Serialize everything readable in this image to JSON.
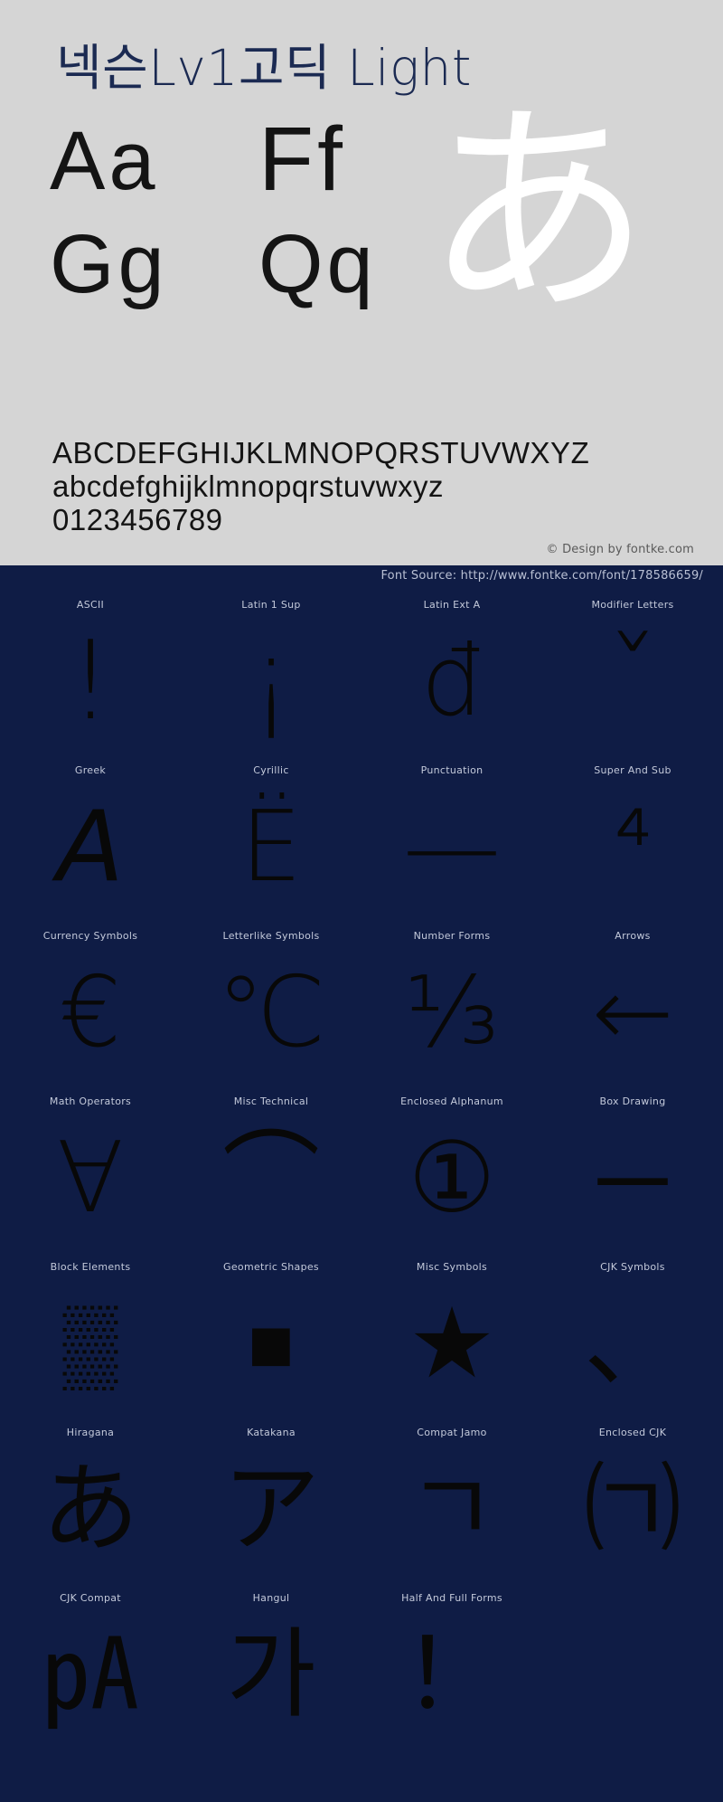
{
  "specimen": {
    "title": "넥슨Lv1고딕 Light",
    "sample_pairs": [
      "Aa",
      "Ff",
      "Gg",
      "Qq"
    ],
    "decorative_glyph": "あ",
    "alphabet_upper": "ABCDEFGHIJKLMNOPQRSTUVWXYZ",
    "alphabet_lower": "abcdefghijklmnopqrstuvwxyz",
    "digits": "0123456789",
    "credit": "© Design by fontke.com",
    "colors": {
      "background": "#d5d5d5",
      "title": "#1b2a52",
      "glyph": "#141414",
      "decorative": "#ffffff",
      "credit": "#5a5a5a"
    }
  },
  "charset": {
    "source_text": "Font Source: http://www.fontke.com/font/178586659/",
    "colors": {
      "background": "#0f1c45",
      "label": "#c3c9da",
      "glyph": "#080808",
      "source": "#b9c0d4"
    },
    "rows": [
      [
        {
          "label": "ASCII",
          "glyph": "!",
          "size": "lg"
        },
        {
          "label": "Latin 1 Sup",
          "glyph": "¡",
          "size": "lg"
        },
        {
          "label": "Latin Ext A",
          "glyph": "đ",
          "size": ""
        },
        {
          "label": "Modifier Letters",
          "glyph": "ˇ",
          "size": "lg"
        }
      ],
      [
        {
          "label": "Greek",
          "glyph": "Α",
          "size": "it"
        },
        {
          "label": "Cyrillic",
          "glyph": "Ё",
          "size": ""
        },
        {
          "label": "Punctuation",
          "glyph": "—",
          "size": ""
        },
        {
          "label": "Super And Sub",
          "glyph": "⁴",
          "size": ""
        }
      ],
      [
        {
          "label": "Currency Symbols",
          "glyph": "€",
          "size": ""
        },
        {
          "label": "Letterlike Symbols",
          "glyph": "℃",
          "size": ""
        },
        {
          "label": "Number Forms",
          "glyph": "⅓",
          "size": ""
        },
        {
          "label": "Arrows",
          "glyph": "←",
          "size": ""
        }
      ],
      [
        {
          "label": "Math Operators",
          "glyph": "∀",
          "size": ""
        },
        {
          "label": "Misc Technical",
          "glyph": "⌒",
          "size": ""
        },
        {
          "label": "Enclosed Alphanum",
          "glyph": "①",
          "size": ""
        },
        {
          "label": "Box Drawing",
          "glyph": "─",
          "size": ""
        }
      ],
      [
        {
          "label": "Block Elements",
          "glyph": "▒",
          "size": "sm"
        },
        {
          "label": "Geometric Shapes",
          "glyph": "■",
          "size": "sm"
        },
        {
          "label": "Misc Symbols",
          "glyph": "★",
          "size": ""
        },
        {
          "label": "CJK Symbols",
          "glyph": "、",
          "size": ""
        }
      ],
      [
        {
          "label": "Hiragana",
          "glyph": "あ",
          "size": ""
        },
        {
          "label": "Katakana",
          "glyph": "ア",
          "size": ""
        },
        {
          "label": "Compat Jamo",
          "glyph": "ㄱ",
          "size": ""
        },
        {
          "label": "Enclosed CJK",
          "glyph": "㈀",
          "size": ""
        }
      ],
      [
        {
          "label": "CJK Compat",
          "glyph": "㎀",
          "size": ""
        },
        {
          "label": "Hangul",
          "glyph": "가",
          "size": ""
        },
        {
          "label": "Half And Full Forms",
          "glyph": "！",
          "size": ""
        },
        {
          "label": "",
          "glyph": "",
          "size": ""
        }
      ]
    ]
  }
}
